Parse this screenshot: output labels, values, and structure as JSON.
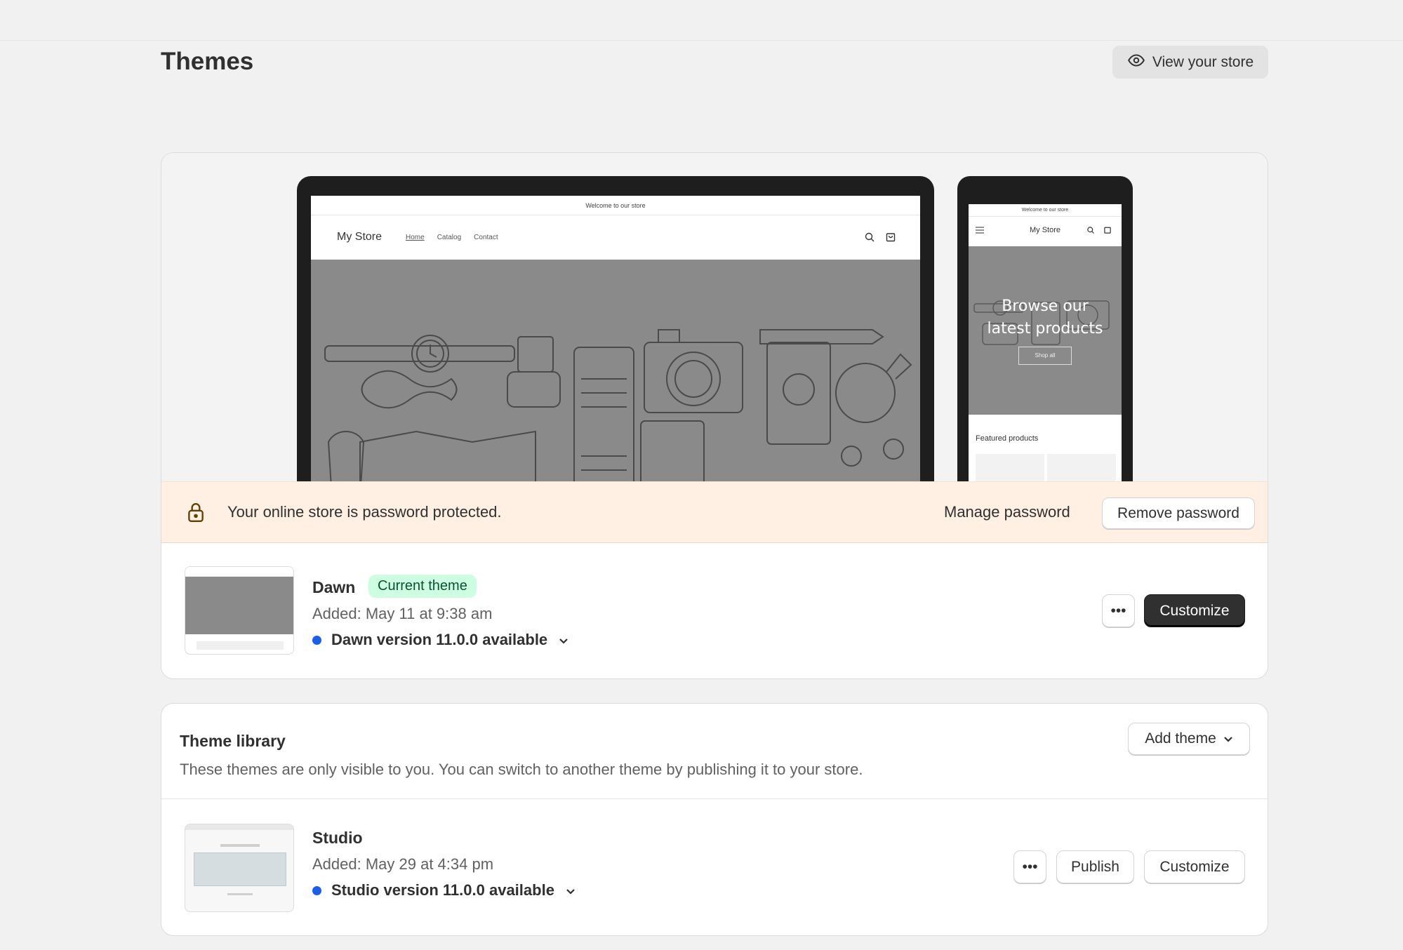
{
  "page": {
    "title": "Themes",
    "view_store_label": "View your store"
  },
  "current_theme_card": {
    "preview": {
      "desktop": {
        "announcement": "Welcome to our store",
        "logo": "My Store",
        "nav": [
          "Home",
          "Catalog",
          "Contact"
        ]
      },
      "mobile": {
        "announcement": "Welcome to our store",
        "logo": "My Store",
        "hero_title_line1": "Browse our",
        "hero_title_line2": "latest products",
        "hero_button": "Shop all",
        "featured_heading": "Featured products"
      }
    },
    "password_banner": {
      "message": "Your online store is password protected.",
      "manage_label": "Manage password",
      "remove_label": "Remove password"
    },
    "theme": {
      "name": "Dawn",
      "badge": "Current theme",
      "added": "Added: May 11 at 9:38 am",
      "version": "Dawn version 11.0.0 available",
      "more_label": "•••",
      "customize_label": "Customize"
    }
  },
  "theme_library": {
    "title": "Theme library",
    "description": "These themes are only visible to you. You can switch to another theme by publishing it to your store.",
    "add_theme_label": "Add theme",
    "themes": [
      {
        "name": "Studio",
        "added": "Added: May 29 at 4:34 pm",
        "version": "Studio version 11.0.0 available",
        "more_label": "•••",
        "publish_label": "Publish",
        "customize_label": "Customize"
      }
    ]
  },
  "colors": {
    "background": "#f1f1f1",
    "banner_bg": "#fff0e3",
    "badge_bg": "#cdfee1",
    "badge_text": "#0c5132",
    "update_dot": "#1c5ee5",
    "primary_button": "#303030"
  }
}
